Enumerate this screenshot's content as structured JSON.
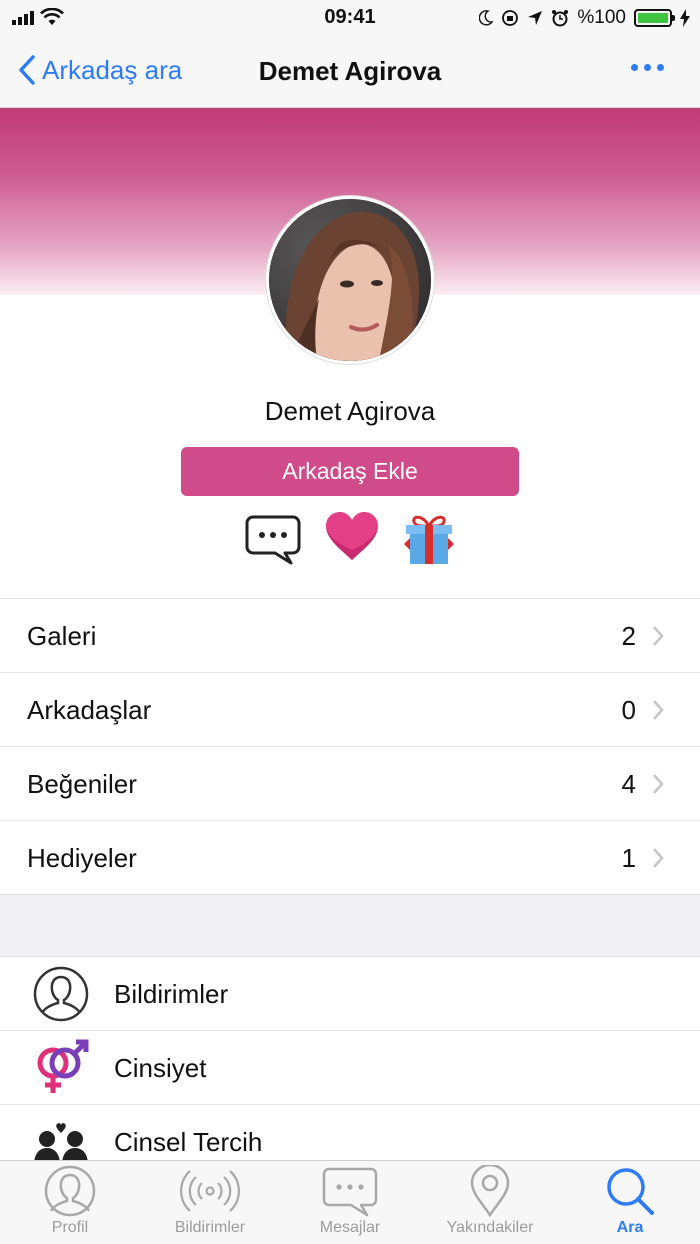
{
  "status_bar": {
    "time": "09:41",
    "battery_label": "%100"
  },
  "nav": {
    "back_label": "Arkadaş ara",
    "title": "Demet Agirova"
  },
  "profile": {
    "name": "Demet Agirova",
    "add_friend_label": "Arkadaş Ekle"
  },
  "stats": [
    {
      "label": "Galeri",
      "count": "2"
    },
    {
      "label": "Arkadaşlar",
      "count": "0"
    },
    {
      "label": "Beğeniler",
      "count": "4"
    },
    {
      "label": "Hediyeler",
      "count": "1"
    }
  ],
  "settings": [
    {
      "label": "Bildirimler",
      "icon": "person-outline-icon"
    },
    {
      "label": "Cinsiyet",
      "icon": "gender-symbols-icon"
    },
    {
      "label": "Cinsel Tercih",
      "icon": "couple-icon"
    }
  ],
  "tabs": [
    {
      "label": "Profil",
      "icon": "profile-icon"
    },
    {
      "label": "Bildirimler",
      "icon": "broadcast-icon"
    },
    {
      "label": "Mesajlar",
      "icon": "message-icon"
    },
    {
      "label": "Yakındakiler",
      "icon": "location-pin-icon"
    },
    {
      "label": "Ara",
      "icon": "search-icon",
      "active": true
    }
  ],
  "colors": {
    "accent": "#2d7cf6",
    "brand": "#cf4b8a",
    "battery": "#3ec43e"
  }
}
